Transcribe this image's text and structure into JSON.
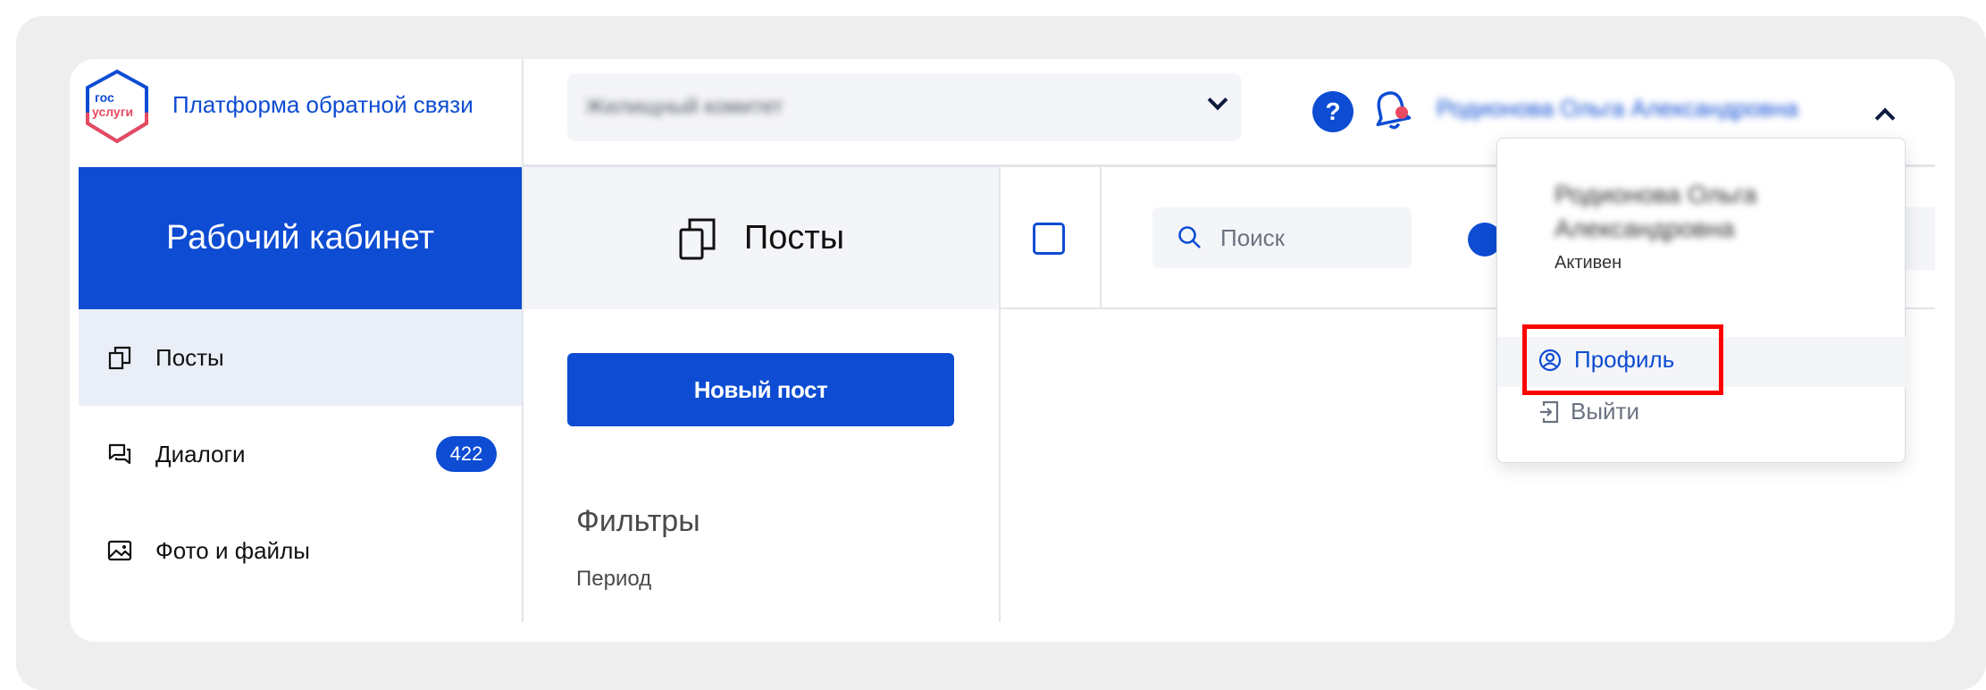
{
  "app": {
    "title": "Платформа обратной связи",
    "logo_text_line1": "гос",
    "logo_text_line2": "услуги"
  },
  "header": {
    "org_select_value": "Жилищный комитет",
    "help_label": "?",
    "user_name": "Родионова Ольга Александровна"
  },
  "sidebar": {
    "title": "Рабочий кабинет",
    "items": [
      {
        "label": "Посты",
        "icon": "copy-icon"
      },
      {
        "label": "Диалоги",
        "icon": "chat-icon",
        "badge": "422"
      },
      {
        "label": "Фото и файлы",
        "icon": "image-icon"
      }
    ]
  },
  "posts": {
    "title": "Посты",
    "new_post_label": "Новый пост",
    "filters_label": "Фильтры",
    "period_label": "Период"
  },
  "toolbar": {
    "search_placeholder": "Поиск"
  },
  "user_menu": {
    "name": "Родионова Ольга Александровна",
    "status": "Активен",
    "profile_label": "Профиль",
    "logout_label": "Выйти"
  },
  "colors": {
    "accent": "#0d4cd3",
    "highlight": "#ff0000",
    "notification_dot": "#e84a5f"
  }
}
